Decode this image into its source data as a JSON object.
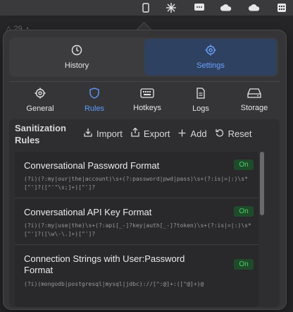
{
  "menubar": {
    "icons": [
      "phone-icon",
      "burst-icon",
      "chat-icon",
      "cloud-icon",
      "cloud-icon",
      "calendar-icon"
    ]
  },
  "background": {
    "peek_text": "△ 29   ◔"
  },
  "top_segments": [
    {
      "id": "history",
      "label": "History",
      "icon": "clock-icon",
      "selected": false
    },
    {
      "id": "settings",
      "label": "Settings",
      "icon": "gear-icon",
      "selected": true
    }
  ],
  "tabs": [
    {
      "id": "general",
      "label": "General",
      "icon": "gear-icon",
      "active": false
    },
    {
      "id": "rules",
      "label": "Rules",
      "icon": "shield-icon",
      "active": true
    },
    {
      "id": "hotkeys",
      "label": "Hotkeys",
      "icon": "keyboard-icon",
      "active": false
    },
    {
      "id": "logs",
      "label": "Logs",
      "icon": "document-icon",
      "active": false
    },
    {
      "id": "storage",
      "label": "Storage",
      "icon": "drive-icon",
      "active": false
    }
  ],
  "rules_panel": {
    "title": "Sanitization Rules",
    "actions": {
      "import": "Import",
      "export": "Export",
      "add": "Add",
      "reset": "Reset"
    },
    "rules": [
      {
        "name": "Conversational Password Format",
        "pattern": "(?i)(?:my|our|the|account)\\s+(?:password|pwd|pass)\\s+(?:is|=|:)\\s*[\"']?([^'\"\\s;]+)[\"']?",
        "status": "On"
      },
      {
        "name": "Conversational API Key Format",
        "pattern": "(?i)(?:my|use|the)\\s+(?:api[_-]?key|auth[_-]?token)\\s+(?:is|=|:)\\s*[\"']?([\\w\\-\\.]+)[\"']?",
        "status": "On"
      },
      {
        "name": "Connection Strings with User:Password Format",
        "pattern": "(?i)(mongodb|postgresql|mysql|jdbc)://[^:@]+:([^@]+)@",
        "status": "On"
      }
    ]
  },
  "colors": {
    "accent": "#5e9bff",
    "settings_bg": "#2f4160",
    "on_badge_bg": "#1f4b2b",
    "on_badge_text": "#4fd16a"
  }
}
